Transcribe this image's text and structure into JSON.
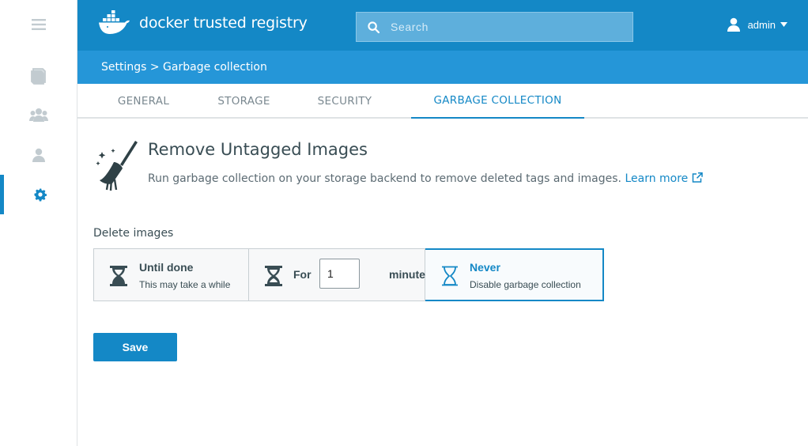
{
  "app": {
    "logo_text": "docker trusted registry"
  },
  "search": {
    "placeholder": "Search"
  },
  "user": {
    "name": "admin"
  },
  "breadcrumb": "Settings > Garbage collection",
  "sidebar": {
    "items": [
      {
        "icon": "menu-icon"
      },
      {
        "icon": "repositories-icon"
      },
      {
        "icon": "organizations-icon"
      },
      {
        "icon": "users-icon"
      },
      {
        "icon": "settings-icon",
        "active": true
      }
    ]
  },
  "tabs": [
    {
      "label": "GENERAL"
    },
    {
      "label": "STORAGE"
    },
    {
      "label": "SECURITY"
    },
    {
      "label": "GARBAGE COLLECTION",
      "active": true
    }
  ],
  "content": {
    "title": "Remove Untagged Images",
    "description": "Run garbage collection on your storage backend to remove deleted tags and images.",
    "learn_more": "Learn more",
    "section_label": "Delete images",
    "options": {
      "until_done": {
        "title": "Until done",
        "subtitle": "This may take a while"
      },
      "for": {
        "prefix": "For",
        "value": "1",
        "suffix": "minutes"
      },
      "never": {
        "title": "Never",
        "subtitle": "Disable garbage collection",
        "selected": true
      }
    },
    "save_label": "Save"
  },
  "colors": {
    "primary": "#1488c6",
    "breadcrumb_bg": "#2596d8",
    "text": "#394d54"
  }
}
